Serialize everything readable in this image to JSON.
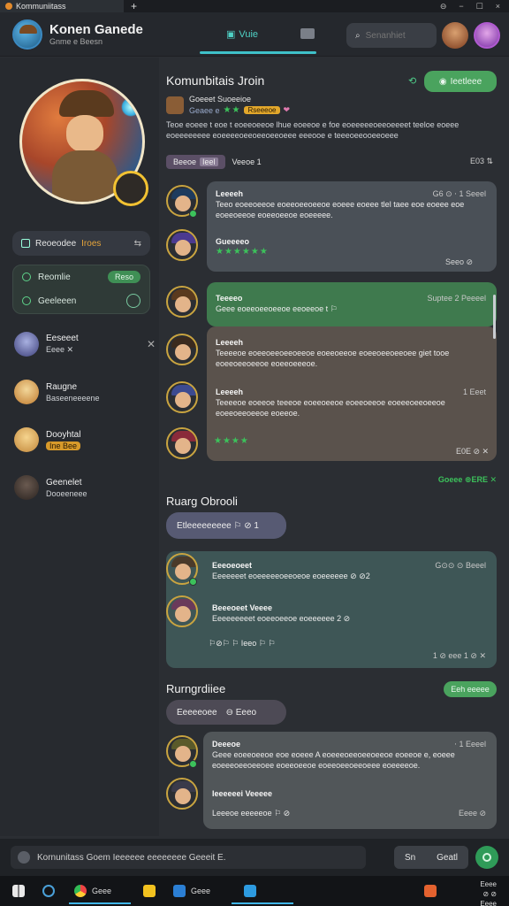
{
  "window": {
    "tab_title": "Kommuniitass",
    "new_tab": "+",
    "controls": [
      "⊖",
      "−",
      "☐",
      "×"
    ]
  },
  "header": {
    "app_title": "Konen Ganede",
    "app_subtitle": "Gnme e Beesn",
    "nav_tab": "Vuie",
    "search_placeholder": "Senanhiet"
  },
  "sidebar": {
    "pill": {
      "label": "Reoeodee",
      "highlight": "Iroes",
      "right": "⇆"
    },
    "status": [
      {
        "label": "Reomlie",
        "tag": "Reso"
      },
      {
        "label": "Geeleeen"
      }
    ],
    "friends": [
      {
        "name": "Eeseeet",
        "sub": "Eeee ✕",
        "close": "✕"
      },
      {
        "name": "Raugne",
        "sub": "Baseeneeeene"
      },
      {
        "name": "Dooyhtal",
        "sub": "Ine Bee"
      },
      {
        "name": "Geenelet",
        "sub": "Dooeeneee"
      }
    ]
  },
  "main": {
    "title": "Komunbitais Jroin",
    "join_button": "Ieetleee",
    "game_name": "Goeeet Suoeeioe",
    "game_sub": "Geaee e",
    "game_badge": "Rseeeoe",
    "description": "Teoe eoeee t eoe t eoeeoeeoe lhue eoeeoe e foe eoeeeeeoeeoeeeet teeloe eoeee eoeeeeeeee eoeeeeoeeoeeoeeoeee eeeooe e teeeoeeooeeoeee",
    "filter_chip": "Beeoe",
    "filter_chip_badge": "Ieel",
    "filter_label": "Veeoe 1",
    "filter_right": "E03 ⇅",
    "messages": [
      {
        "name": "Leeeeh",
        "time": "G6 ⊙ ⋅ 1 Seeel",
        "text": "Teeo eoeeoeeoe eoeeoeeoeeoe eoeee eoeee tlel taee eoe eoeee eoe eoeeoeeoe eoeeoeeoe eoeeeee."
      },
      {
        "name": "Gueeeeo",
        "stars": "★★★★★★",
        "time": "Seeo ⊘"
      },
      {
        "name": "Teeeeo",
        "time": "Suptee 2 Peeeel",
        "text": "Geee eoeeoeeoeeoe eeoeeoe t ⚐"
      },
      {
        "name": "Leeeeh",
        "text": "Teeeeoe eoeeoeeoeeoeeoe eoeeoeeoe eoeeoeeoeeoee giet tooe eoeeoeeoeeoe eoeeoeeeoe."
      },
      {
        "name": "Leeeeh",
        "time": "1 Eeet",
        "text": "Teeeeoe eoeeoe teeeoe eoeeoeeoe eoeeoeeoe eoeeeoeeoeeoe eoeeoeeoeeoe eoeeoe."
      },
      {
        "stars": "★★★★",
        "time": "E0E ⊘ ✕"
      }
    ],
    "green_status": "Goeee ⊕ERE ✕",
    "section2_title": "Ruarg Obrooli",
    "section2_pill": "Etleeeeeeeee ⚐ ⊘ 1",
    "section2": [
      {
        "name": "Eeeoeoeet",
        "time": "G⊙⊙ ⊙ Beeel",
        "text": "Eeeeeeet eoeeeeeoeeoeoe eoeeeeee ⊘ ⊘2"
      },
      {
        "name": "Beeeoeet Veeee",
        "text": "Eeeeeeeeet eoeeoeeoe eoeeeeee 2 ⊘"
      },
      {
        "reactions": "⚐⊘⚐ ⚐ Ieeo ⚐ ⚐",
        "time": "1 ⊘ eee 1 ⊘ ✕"
      }
    ],
    "section3_title": "Rurngrdiiee",
    "section3_button": "Eeh eeeee",
    "section3_pill": [
      "Eeeeeoee",
      "⊖ Eeeo"
    ],
    "section3": [
      {
        "name": "Deeeoe",
        "time": "⋅ 1 Eeeel",
        "text": "Geee eoeeoeeoe eoe eoeee A eoeeeoeeoeeoeeoe eoeeoe e, eoeee eoeeeoeeoeeoee eoeeoeeoe eoeeoeeoeeoeee eoeeeeoe."
      },
      {
        "name": "Ieeeeeei Veeeee"
      },
      {
        "text": "Leeeoe eeeeeoe ⚐ ⊘",
        "time": "Eeee ⊘"
      }
    ]
  },
  "compose": {
    "placeholder": "Kornunitass Goem Ieeeeee eeeeeeee Geeeit E.",
    "button_left": "Sn",
    "button_right": "Geatl"
  },
  "taskbar": {
    "items": [
      "Geee",
      "Geee"
    ],
    "clock": [
      "Eeee",
      "⊘ ⊘",
      "Eeee"
    ]
  }
}
